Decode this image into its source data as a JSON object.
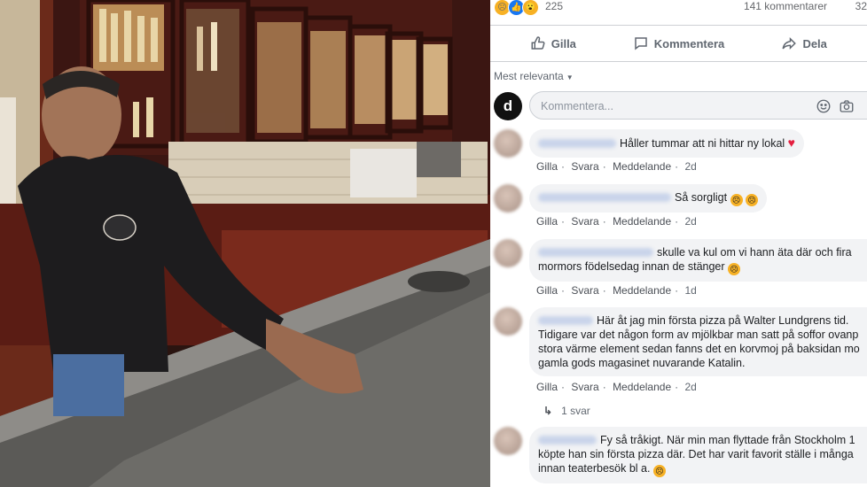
{
  "post": {
    "reaction_count": "225",
    "comment_count": "141 kommentarer",
    "share_count": "32",
    "actions": {
      "like": "Gilla",
      "comment": "Kommentera",
      "share": "Dela"
    },
    "sort_label": "Mest relevanta",
    "composer_placeholder": "Kommentera...",
    "page_logo": "d"
  },
  "comments": [
    {
      "text": "Håller tummar att ni hittar ny lokal",
      "suffix_icon": "heart",
      "meta": {
        "like": "Gilla",
        "reply": "Svara",
        "message": "Meddelande",
        "time": "2d"
      }
    },
    {
      "text": "Så sorgligt",
      "suffix_icon": "sad-faces",
      "meta": {
        "like": "Gilla",
        "reply": "Svara",
        "message": "Meddelande",
        "time": "2d"
      }
    },
    {
      "text": "skulle va kul om vi hann äta där och fira",
      "text2": "mormors födelsedag innan de stänger",
      "suffix_icon": "sad-face",
      "meta": {
        "like": "Gilla",
        "reply": "Svara",
        "message": "Meddelande",
        "time": "1d"
      }
    },
    {
      "text": "Här åt jag min första pizza på Walter Lundgrens tid.",
      "text2": "Tidigare var det någon form av mjölkbar man satt på soffor ovanp",
      "text3": "stora värme element sedan fanns det en korvmoj på baksidan mo",
      "text4": "gamla gods magasinet nuvarande Katalin.",
      "meta": {
        "like": "Gilla",
        "reply": "Svara",
        "message": "Meddelande",
        "time": "2d"
      },
      "replies": "1 svar"
    },
    {
      "text": "Fy så tråkigt. När min man flyttade från Stockholm 1",
      "text2": "köpte han sin första pizza där. Det har varit favorit ställe i många",
      "text3": "innan teaterbesök bl a.",
      "suffix_icon": "sad-face"
    }
  ],
  "colors": {
    "accent": "#1877f2",
    "bubble": "#f2f3f5",
    "muted": "#606770"
  }
}
